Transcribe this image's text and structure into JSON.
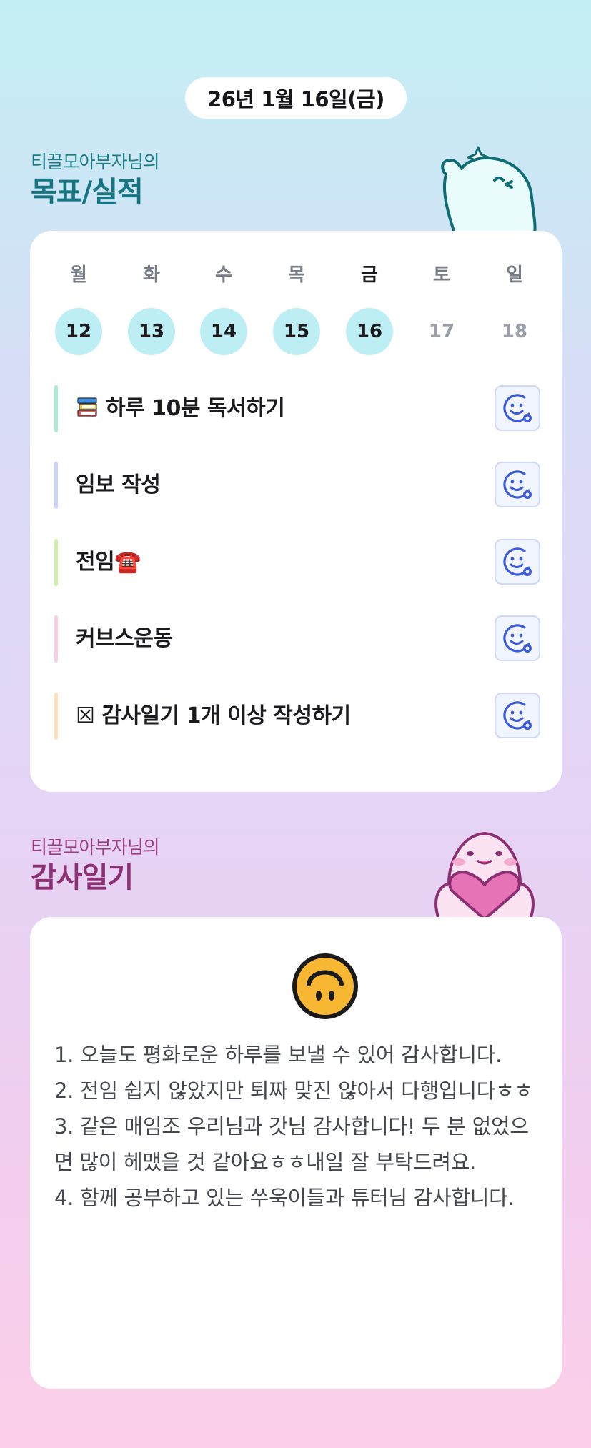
{
  "date_label": "26년 1월 16일(금)",
  "goals_section": {
    "owner": "티끌모아부자님의",
    "title": "목표/실적"
  },
  "week": [
    {
      "name": "월",
      "num": "12",
      "state": "filled"
    },
    {
      "name": "화",
      "num": "13",
      "state": "filled"
    },
    {
      "name": "수",
      "num": "14",
      "state": "filled"
    },
    {
      "name": "목",
      "num": "15",
      "state": "filled"
    },
    {
      "name": "금",
      "num": "16",
      "state": "filled",
      "today": true
    },
    {
      "name": "토",
      "num": "17",
      "state": "empty"
    },
    {
      "name": "일",
      "num": "18",
      "state": "empty"
    }
  ],
  "goals": [
    {
      "label": "하루 10분 독서하기",
      "icon": "books-icon",
      "bar_color": "#a8ecd2"
    },
    {
      "label": "임보 작성",
      "bar_color": "#c9d4fb"
    },
    {
      "label": "전임☎️",
      "bar_color": "#cdf0a6"
    },
    {
      "label": "커브스운동",
      "bar_color": "#f9cde6"
    },
    {
      "label": "☒ 감사일기 1개 이상 작성하기",
      "bar_color": "#fde0b8"
    }
  ],
  "goal_action_icon": "smiley-add-icon",
  "diary_section": {
    "owner": "티끌모아부자님의",
    "title": "감사일기"
  },
  "diary": {
    "mood_icon": "upside-down-face-icon",
    "entries": [
      "1. 오늘도 평화로운 하루를 보낼 수 있어 감사합니다.",
      "2. 전임 쉽지 않았지만 퇴짜 맞진 않아서 다행입니다ㅎㅎ",
      "3. 같은 매임조 우리님과 갓님 감사합니다! 두 분 없었으면 많이 헤맸을 것 같아요ㅎㅎ내일 잘 부탁드려요.",
      "4. 함께 공부하고 있는 쑤욱이들과 튜터님 감사합니다."
    ]
  },
  "colors": {
    "goal_title": "#177582",
    "diary_title": "#8d2f73",
    "day_fill": "#bdeef3",
    "action_icon": "#3b5bdb"
  }
}
